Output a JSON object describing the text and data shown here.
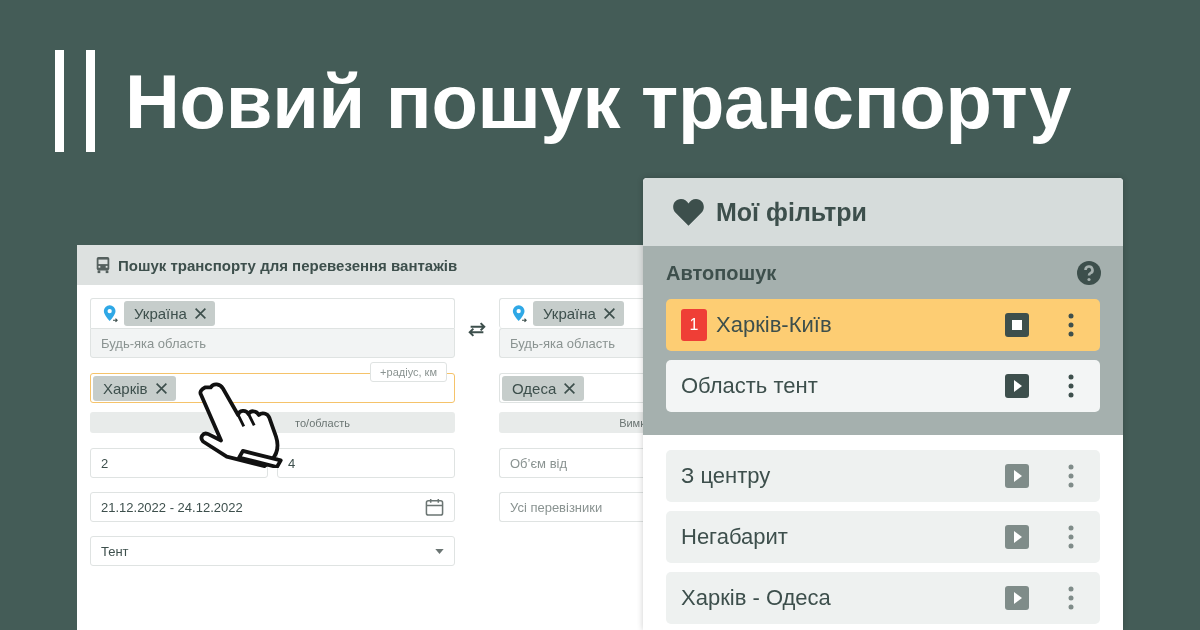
{
  "headline": "Новий пошук транспорту",
  "search_form": {
    "title": "Пошук транспорту для перевезення вантажів",
    "from": {
      "country_tag": "Україна",
      "region_placeholder": "Будь-яка область",
      "city_tag": "Харків",
      "focused": true,
      "radius_label": "+радіус, км",
      "hint": "то/область"
    },
    "to": {
      "country_tag": "Україна",
      "region_placeholder": "Будь-яка область",
      "city_tag": "Одеса",
      "focused": false,
      "hint": "Вимк"
    },
    "weight_from": "2",
    "weight_to": "4",
    "dates": "21.12.2022 - 24.12.2022",
    "body_type": "Тент",
    "volume_placeholder": "Об’єм від",
    "carriers_placeholder": "Усі перевізники"
  },
  "filters_panel": {
    "title": "Мої фільтри",
    "autosearch": {
      "title": "Автопошук",
      "items": [
        {
          "name": "Харків-Київ",
          "badge": "1",
          "running": true
        },
        {
          "name": "Область тент",
          "running": false
        }
      ]
    },
    "saved": [
      {
        "name": "З центру",
        "running": false
      },
      {
        "name": "Негабарит",
        "running": false
      },
      {
        "name": "Харків - Одеса",
        "running": false
      }
    ]
  }
}
